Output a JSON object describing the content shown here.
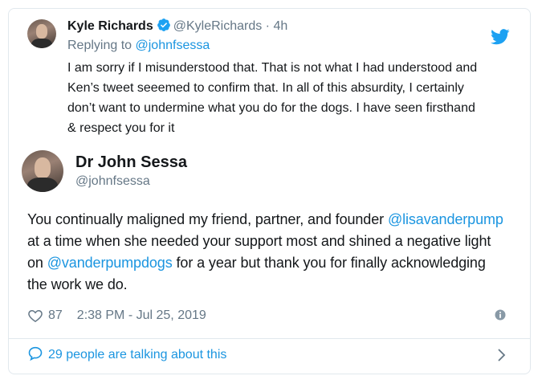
{
  "quoted_tweet": {
    "name": "Kyle Richards",
    "handle": "@KyleRichards",
    "time": "· 4h",
    "replying_prefix": "Replying to",
    "replying_to": "@johnfsessa",
    "text": "I am sorry if I misunderstood that. That is not what I had understood and Ken’s tweet seeemed to confirm that. In all of this absurdity,  I certainly don’t want to undermine what you do for the dogs. I have seen firsthand & respect you for it"
  },
  "main_tweet": {
    "name": "Dr John Sessa",
    "handle": "@johnfsessa",
    "text_parts": {
      "p1": "You continually maligned my friend, partner, and founder",
      "mention1": "@lisavanderpump",
      "p2": "at a time when she needed your support most and shined a negative light on",
      "mention2": "@vanderpumpdogs",
      "p3": "for a year but thank you for finally acknowledging the work we do."
    },
    "likes": "87",
    "timestamp": "2:38 PM - Jul 25, 2019"
  },
  "footer": {
    "talking": "29 people are talking about this"
  },
  "colors": {
    "link": "#1b95e0",
    "muted": "#657786",
    "text": "#14171a",
    "border": "#e1e8ed"
  },
  "icons": [
    "verified-badge-icon",
    "twitter-bird-icon",
    "heart-icon",
    "info-icon",
    "speech-bubble-icon",
    "chevron-right-icon"
  ]
}
